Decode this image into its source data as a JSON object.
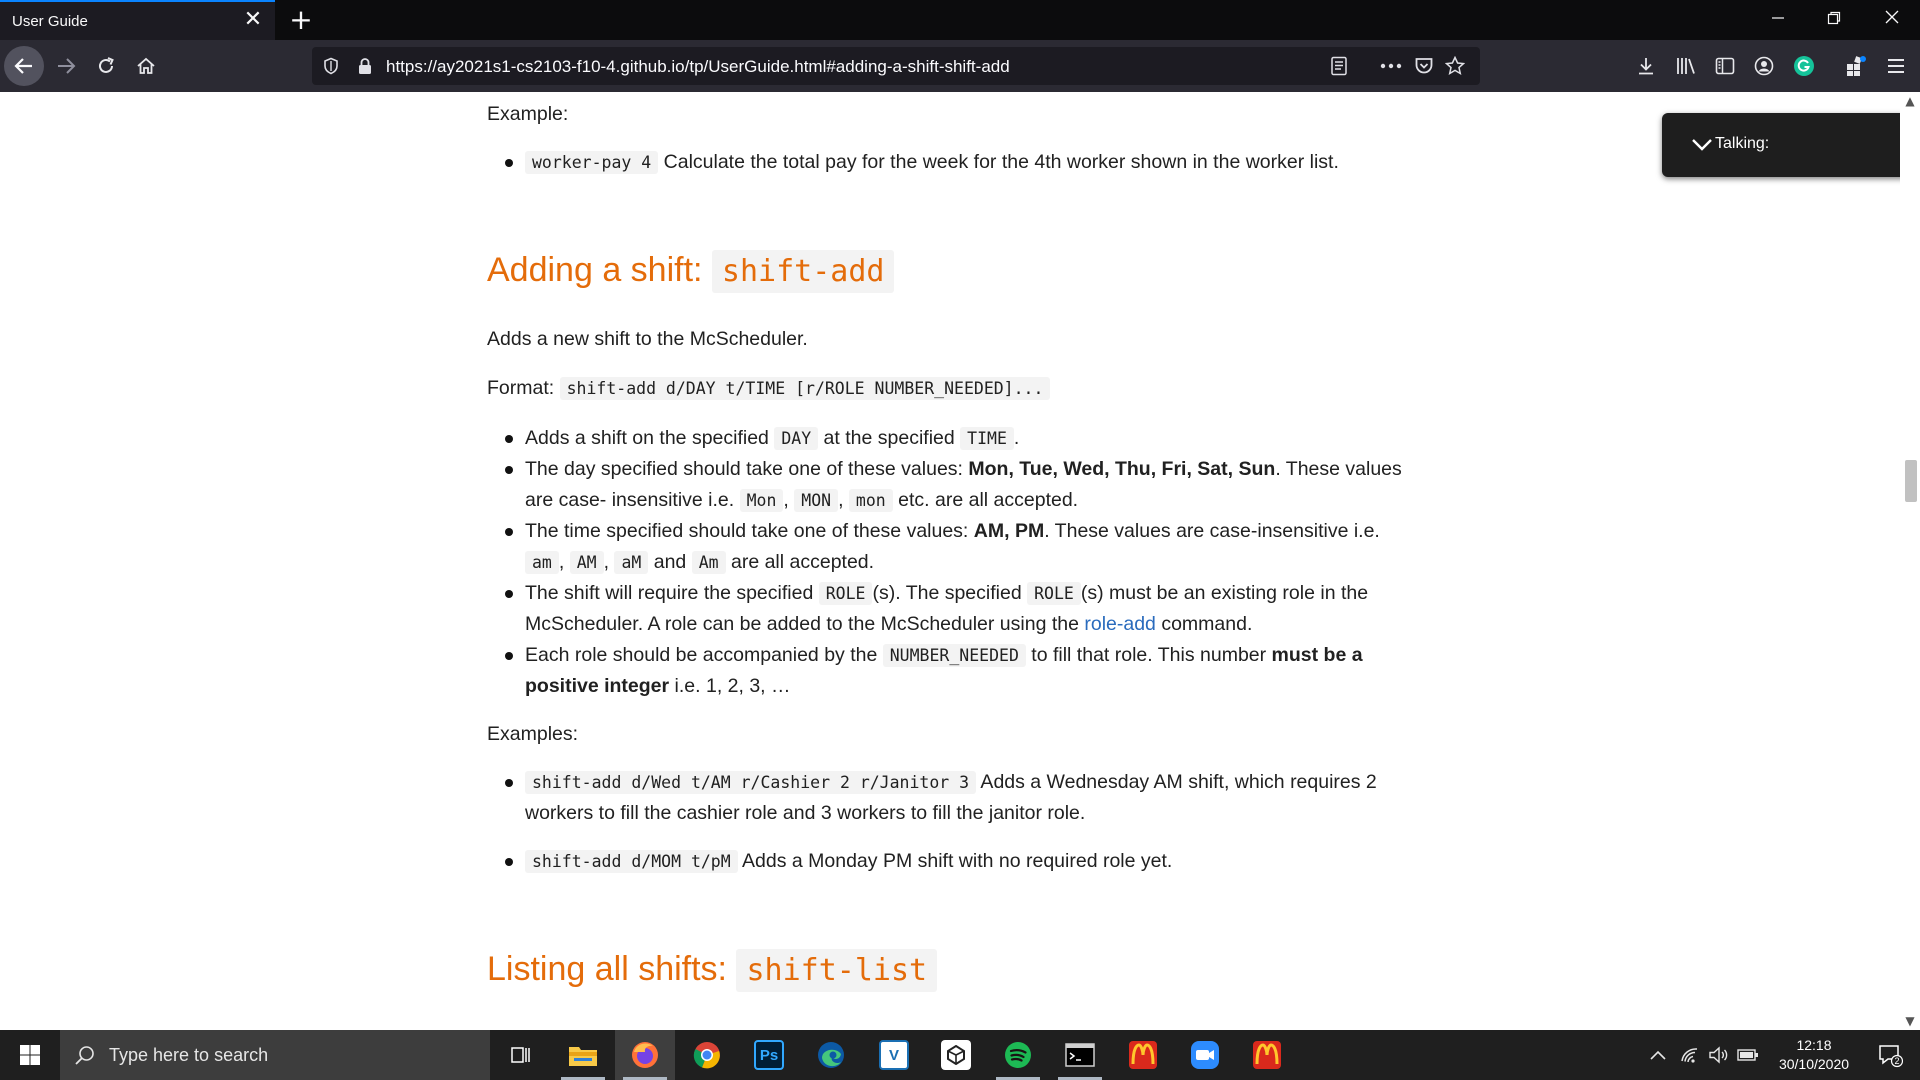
{
  "browser": {
    "tab_title": "User Guide",
    "url": "https://ay2021s1-cs2103-f10-4.github.io/tp/UserGuide.html#adding-a-shift-shift-add"
  },
  "article": {
    "example_label": "Example:",
    "worker_pay": {
      "code": "worker-pay 4",
      "text": " Calculate the total pay for the week for the 4th worker shown in the worker list."
    },
    "section_heading": {
      "text": "Adding a shift: ",
      "code": "shift-add"
    },
    "intro": "Adds a new shift to the McScheduler.",
    "format": {
      "label": "Format: ",
      "code": "shift-add d/DAY t/TIME [r/ROLE NUMBER_NEEDED]..."
    },
    "bullets": {
      "b1": {
        "t1": "Adds a shift on the specified ",
        "c1": "DAY",
        "t2": " at the specified ",
        "c2": "TIME",
        "t3": "."
      },
      "b2": {
        "t1": "The day specified should take one of these values: ",
        "bold": "Mon, Tue, Wed, Thu, Fri, Sat, Sun",
        "t2": ". These values",
        "t3": "are case- insensitive i.e. ",
        "c1": "Mon",
        "sep1": ", ",
        "c2": "MON",
        "sep2": ", ",
        "c3": "mon",
        "t4": " etc. are all accepted."
      },
      "b3": {
        "t1": "The time specified should take one of these values: ",
        "bold": "AM, PM",
        "t2": ". These values are case-insensitive i.e.",
        "c1": "am",
        "sep1": ", ",
        "c2": "AM",
        "sep2": ", ",
        "c3": "aM",
        "and": " and ",
        "c4": "Am",
        "t3": " are all accepted."
      },
      "b4": {
        "t1": "The shift will require the specified ",
        "c1": "ROLE",
        "t2": "(s). The specified ",
        "c2": "ROLE",
        "t3": "(s) must be an existing role in the",
        "t4": "McScheduler. A role can be added to the McScheduler using the ",
        "link": "role-add",
        "t5": " command."
      },
      "b5": {
        "t1": "Each role should be accompanied by the ",
        "c1": "NUMBER_NEEDED",
        "t2": " to fill that role. This number ",
        "bold1": "must be a",
        "bold2": "positive integer",
        "t3": " i.e. 1, 2, 3, …"
      }
    },
    "examples_label": "Examples:",
    "examples": {
      "e1": {
        "code": "shift-add d/Wed t/AM r/Cashier 2 r/Janitor 3",
        "t1": " Adds a Wednesday AM shift, which requires 2",
        "t2": "workers to fill the cashier role and 3 workers to fill the janitor role."
      },
      "e2": {
        "code": "shift-add d/MOM t/pM",
        "t1": " Adds a Monday PM shift with no required role yet."
      }
    },
    "next_heading": {
      "text": "Listing all shifts: ",
      "code": "shift-list"
    }
  },
  "overlay": {
    "label": "Talking:"
  },
  "taskbar": {
    "search_placeholder": "Type here to search",
    "time": "12:18",
    "date": "30/10/2020",
    "notification_count": "2",
    "apps": [
      "task-view",
      "file-explorer",
      "firefox",
      "chrome",
      "photoshop",
      "edge",
      "visual-paradigm",
      "unity",
      "spotify",
      "terminal",
      "mcdonalds",
      "zoom",
      "mcdonalds"
    ]
  },
  "colors": {
    "heading": "#e46c0a",
    "link": "#2a6bbd",
    "tab_accent": "#0a84ff"
  }
}
